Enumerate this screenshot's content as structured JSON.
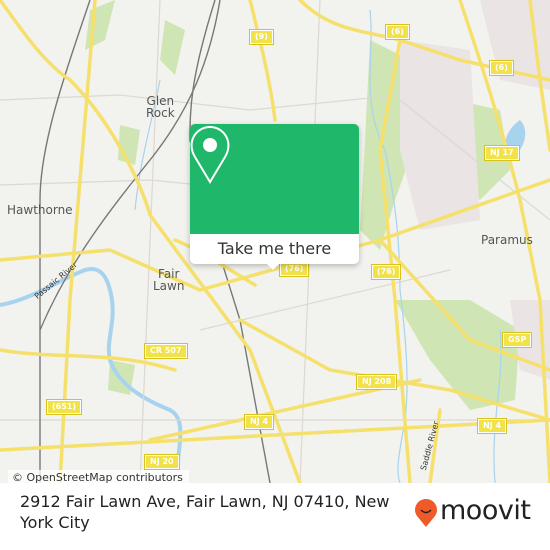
{
  "map": {
    "places": [
      {
        "id": "glen-rock",
        "label": "Glen\nRock"
      },
      {
        "id": "hawthorne",
        "label": "Hawthorne"
      },
      {
        "id": "fair-lawn",
        "label": "Fair\nLawn"
      },
      {
        "id": "paramus",
        "label": "Paramus"
      }
    ],
    "river_labels": {
      "passaic": "Passaic River",
      "saddle": "Saddle River"
    },
    "shields": [
      {
        "id": "route-9",
        "label": "(9)"
      },
      {
        "id": "route-6-a",
        "label": "(6)"
      },
      {
        "id": "route-6-b",
        "label": "(6)"
      },
      {
        "id": "nj-17",
        "label": "NJ 17"
      },
      {
        "id": "route-76-a",
        "label": "(76)"
      },
      {
        "id": "route-76-b",
        "label": "(76)"
      },
      {
        "id": "gsp",
        "label": "GSP"
      },
      {
        "id": "cr-507",
        "label": "CR 507"
      },
      {
        "id": "nj-208",
        "label": "NJ 208"
      },
      {
        "id": "route-651",
        "label": "(651)"
      },
      {
        "id": "nj-4-a",
        "label": "NJ 4"
      },
      {
        "id": "nj-4-b",
        "label": "NJ 4"
      },
      {
        "id": "nj-20",
        "label": "NJ 20"
      }
    ],
    "attribution": "© OpenStreetMap contributors"
  },
  "popup": {
    "icon": "location-pin-icon",
    "button_label": "Take me there",
    "color": "#1fb86a"
  },
  "footer": {
    "address": "2912 Fair Lawn Ave, Fair Lawn, NJ 07410, New York City",
    "brand": "moovit",
    "brand_color": "#f05a28"
  }
}
